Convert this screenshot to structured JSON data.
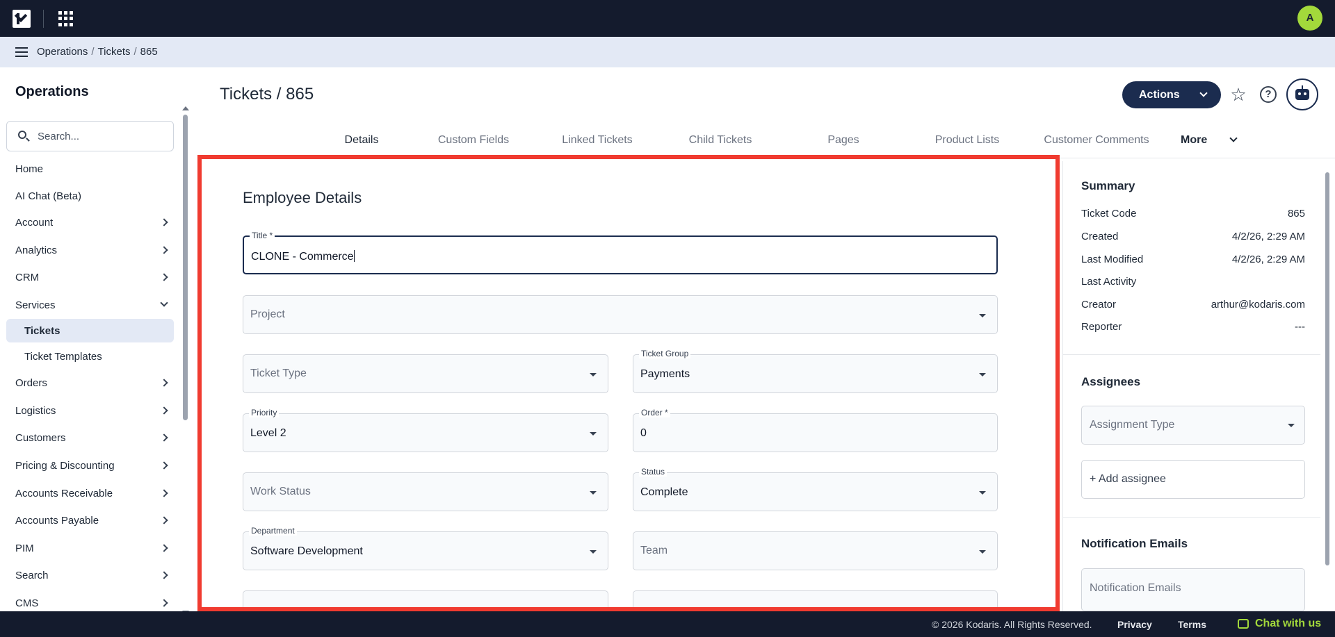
{
  "topbar": {
    "avatar_initial": "A"
  },
  "breadcrumb": [
    "Operations",
    "Tickets",
    "865"
  ],
  "sidebar": {
    "title": "Operations",
    "search_placeholder": "Search...",
    "items": [
      {
        "label": "Home",
        "chevron": false
      },
      {
        "label": "AI Chat (Beta)",
        "chevron": false
      },
      {
        "label": "Account",
        "chevron": true
      },
      {
        "label": "Analytics",
        "chevron": true
      },
      {
        "label": "CRM",
        "chevron": true
      },
      {
        "label": "Services",
        "chevron": true,
        "expanded": true
      },
      {
        "label": "Orders",
        "chevron": true
      },
      {
        "label": "Logistics",
        "chevron": true
      },
      {
        "label": "Customers",
        "chevron": true
      },
      {
        "label": "Pricing & Discounting",
        "chevron": true
      },
      {
        "label": "Accounts Receivable",
        "chevron": true
      },
      {
        "label": "Accounts Payable",
        "chevron": true
      },
      {
        "label": "PIM",
        "chevron": true
      },
      {
        "label": "Search",
        "chevron": true
      },
      {
        "label": "CMS",
        "chevron": true
      }
    ],
    "subitems": [
      {
        "label": "Tickets",
        "active": true
      },
      {
        "label": "Ticket Templates",
        "active": false
      }
    ]
  },
  "header": {
    "title": "Tickets / 865",
    "actions_label": "Actions"
  },
  "tabs": [
    {
      "label": "Details",
      "active": true
    },
    {
      "label": "Custom Fields"
    },
    {
      "label": "Linked Tickets"
    },
    {
      "label": "Child Tickets"
    },
    {
      "label": "Pages"
    },
    {
      "label": "Product Lists"
    },
    {
      "label": "Customer Comments"
    }
  ],
  "more_tab": "More",
  "form": {
    "section_title": "Employee Details",
    "title_label": "Title *",
    "title_value": "CLONE - Commerce",
    "project_placeholder": "Project",
    "ticket_type_placeholder": "Ticket Type",
    "ticket_group_label": "Ticket Group",
    "ticket_group_value": "Payments",
    "priority_label": "Priority",
    "priority_value": "Level 2",
    "order_label": "Order *",
    "order_value": "0",
    "work_status_placeholder": "Work Status",
    "status_label": "Status",
    "status_value": "Complete",
    "department_label": "Department",
    "department_value": "Software Development",
    "team_placeholder": "Team"
  },
  "summary": {
    "title": "Summary",
    "rows": [
      {
        "label": "Ticket Code",
        "value": "865"
      },
      {
        "label": "Created",
        "value": "4/2/26, 2:29 AM"
      },
      {
        "label": "Last Modified",
        "value": "4/2/26, 2:29 AM"
      },
      {
        "label": "Last Activity",
        "value": ""
      },
      {
        "label": "Creator",
        "value": "arthur@kodaris.com"
      },
      {
        "label": "Reporter",
        "value": "---"
      }
    ]
  },
  "assignees": {
    "title": "Assignees",
    "assignment_type_placeholder": "Assignment Type",
    "add_label": "+ Add assignee"
  },
  "notifications": {
    "title": "Notification Emails",
    "placeholder": "Notification Emails"
  },
  "footer": {
    "copyright": "© 2026 Kodaris. All Rights Reserved.",
    "privacy": "Privacy",
    "terms": "Terms",
    "chat": "Chat with us"
  },
  "colors": {
    "topbar": "#141b2d",
    "accent": "#1b2c4f",
    "highlight_border": "#f03b30",
    "avatar": "#a3d93b"
  }
}
